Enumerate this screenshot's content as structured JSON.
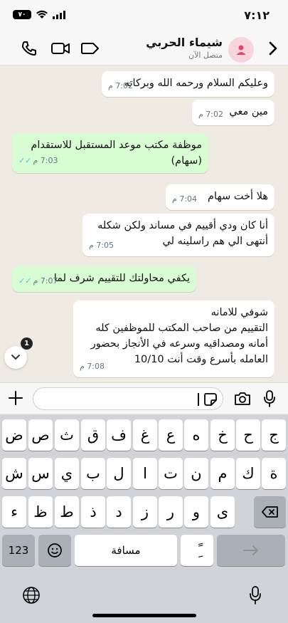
{
  "status": {
    "time": "٧:١٢",
    "battery": "٧٠"
  },
  "header": {
    "name": "شيماء الحربي",
    "presence": "متصل الآن"
  },
  "messages": [
    {
      "dir": "in",
      "text": "وعليكم السلام ورحمه الله وبركاته",
      "time": "7:02 م"
    },
    {
      "dir": "in",
      "text": "مين معي",
      "time": "7:02 م"
    },
    {
      "dir": "out",
      "text": "موظفة مكتب موعد المستقبل للاستقدام\n(سهام)",
      "time": "7:03 م"
    },
    {
      "dir": "in",
      "text": "هلا أخت سهام",
      "time": "7:04 م"
    },
    {
      "dir": "in",
      "text": "أنا كان ودي أقييم في مساند ولكن شكله\nأنتهى الي هم راسلينه لي",
      "time": "7:05 م"
    },
    {
      "dir": "out",
      "text": "يكفي محاولتك للتقييم شرف لما",
      "time": "7:07 م"
    },
    {
      "dir": "in",
      "text": "شوفي للامانه\nالتقييم من صاحب المكتب للموظفين كله\nأمانه ومصداقيه وسرعه في الأنجاز  بحضور\nالعامله بأسرع وقت أنت 10/10",
      "time": "7:08 م"
    }
  ],
  "unread_count": "1",
  "keyboard": {
    "row1": [
      "ض",
      "ص",
      "ث",
      "ق",
      "ف",
      "غ",
      "ع",
      "ه",
      "خ",
      "ح",
      "ج"
    ],
    "row2": [
      "ش",
      "س",
      "ي",
      "ب",
      "ل",
      "ا",
      "ت",
      "ن",
      "م",
      "ك",
      "ة"
    ],
    "row3": [
      "ء",
      "ظ",
      "ط",
      "ذ",
      "د",
      "ز",
      "ر",
      "و",
      "ى"
    ],
    "numbers_key": "123",
    "space_key": "مسافة",
    "diacritic_key": "ًِ"
  },
  "colors": {
    "outgoing": "#d9fdd3",
    "incoming": "#ffffff",
    "ticks": "#53bdeb",
    "background": "#efeae2"
  }
}
